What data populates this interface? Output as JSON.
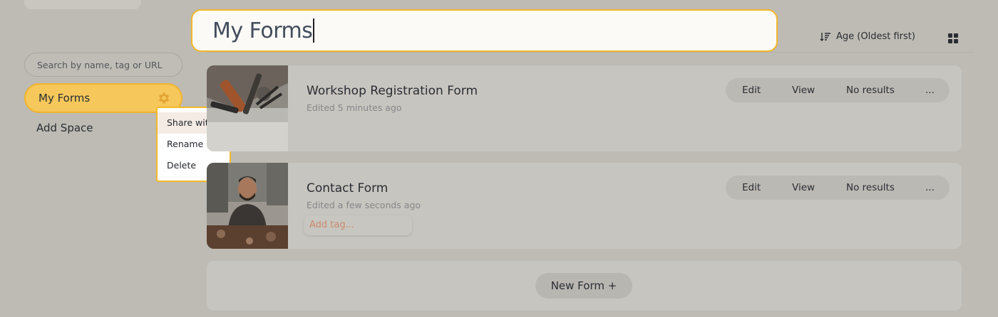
{
  "sidebar": {
    "search_placeholder": "Search by name, tag or URL",
    "active_space": "My Forms",
    "add_space": "Add Space",
    "menu": [
      "Share with...",
      "Rename",
      "Delete"
    ]
  },
  "header": {
    "title": "My Forms",
    "sort_label": "Age (Oldest first)"
  },
  "forms": [
    {
      "title": "Workshop Registration Form",
      "meta": "Edited 5 minutes ago",
      "actions": {
        "edit": "Edit",
        "view": "View",
        "results": "No results",
        "more": "..."
      }
    },
    {
      "title": "Contact Form",
      "meta": "Edited a few seconds ago",
      "tag_placeholder": "Add tag...",
      "actions": {
        "edit": "Edit",
        "view": "View",
        "results": "No results",
        "more": "..."
      }
    }
  ],
  "new_form_label": "New Form +",
  "colors": {
    "accent": "#f6c75a",
    "accent_border": "#f2b62d",
    "background": "#bdbbb4",
    "card": "#c7c5bf"
  }
}
